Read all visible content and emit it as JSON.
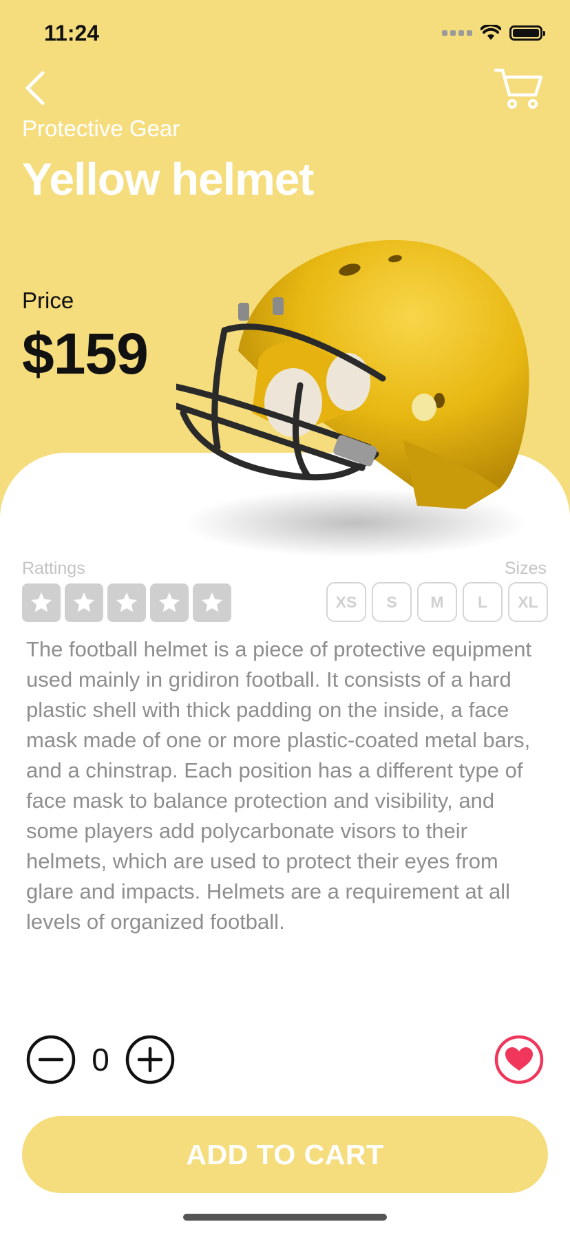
{
  "status_bar": {
    "time": "11:24"
  },
  "header": {
    "back_icon": "chevron-left-icon",
    "cart_icon": "cart-icon"
  },
  "product": {
    "category": "Protective Gear",
    "name": "Yellow helmet",
    "price_label": "Price",
    "price": "$159",
    "image": "yellow-football-helmet"
  },
  "ratings": {
    "label": "Rattings",
    "value": 0,
    "max": 5
  },
  "sizes": {
    "label": "Sizes",
    "options": [
      "XS",
      "S",
      "M",
      "L",
      "XL"
    ]
  },
  "description": "The football helmet is a piece of protective equipment used mainly in gridiron football. It consists of a hard plastic shell with thick padding on the inside, a face mask made of one or more plastic-coated metal bars, and a chinstrap. Each position has a different type of face mask to balance protection and visibility, and some players add polycarbonate visors to their helmets, which are used to protect their eyes from glare and impacts. Helmets are a requirement at all levels of organized football.",
  "quantity": {
    "value": "0",
    "decrement_icon": "minus-circle-icon",
    "increment_icon": "plus-circle-icon"
  },
  "favorite": {
    "icon": "heart-icon",
    "color": "#F0365A"
  },
  "cta": {
    "label": "ADD TO CART"
  },
  "colors": {
    "accent": "#F5DD7E",
    "text_muted": "#8e8e8e"
  }
}
